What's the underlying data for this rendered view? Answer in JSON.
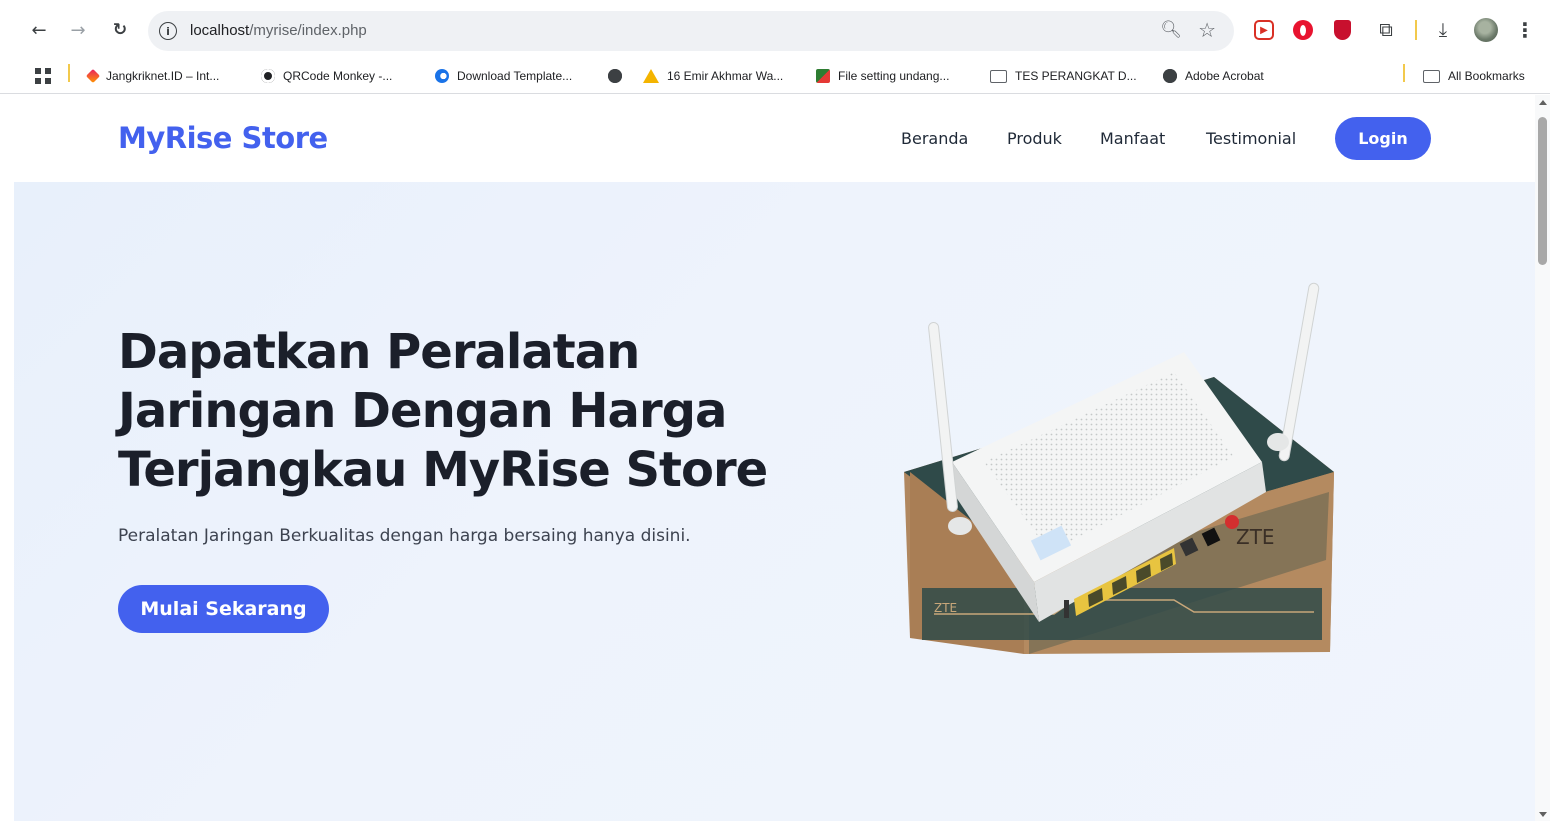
{
  "browser": {
    "url_host": "localhost",
    "url_path": "/myrise/index.php",
    "info_glyph": "i",
    "extensions": [
      "zoom-icon",
      "star-icon",
      "screen-recorder-extension-icon",
      "opera-extension-icon",
      "mcafee-extension-icon",
      "extensions-puzzle-icon",
      "downloads-icon",
      "profile-avatar",
      "more-menu-icon"
    ],
    "bookmarks": [
      {
        "label": "Jangkriknet.ID – Int...",
        "icon": "jangkriknet-favicon"
      },
      {
        "label": "QRCode Monkey -...",
        "icon": "qrcode-monkey-favicon"
      },
      {
        "label": "Download Template...",
        "icon": "download-favicon"
      },
      {
        "label": "",
        "icon": "globe-icon"
      },
      {
        "label": "16 Emir Akhmar Wa...",
        "icon": "google-drive-icon"
      },
      {
        "label": "File setting undang...",
        "icon": "file-favicon"
      },
      {
        "label": "TES PERANGKAT D...",
        "icon": "folder-icon"
      },
      {
        "label": "Adobe Acrobat",
        "icon": "globe-icon"
      }
    ],
    "overflow_glyph": "»",
    "all_bookmarks": "All Bookmarks"
  },
  "site": {
    "brand": "MyRise Store",
    "nav": [
      "Beranda",
      "Produk",
      "Manfaat",
      "Testimonial"
    ],
    "login": "Login",
    "hero": {
      "title": "Dapatkan Peralatan Jaringan Dengan Harga Terjangkau MyRise Store",
      "subtitle": "Peralatan Jaringan Berkualitas dengan harga bersaing hanya disini.",
      "cta": "Mulai Sekarang",
      "product_image": "zte-router-on-box",
      "box_brand_front": "ZTE",
      "box_brand_side": "ZTE"
    }
  },
  "colors": {
    "primary": "#4361ee",
    "hero_bg": "#eaf1fb",
    "heading": "#1b1f2a"
  }
}
